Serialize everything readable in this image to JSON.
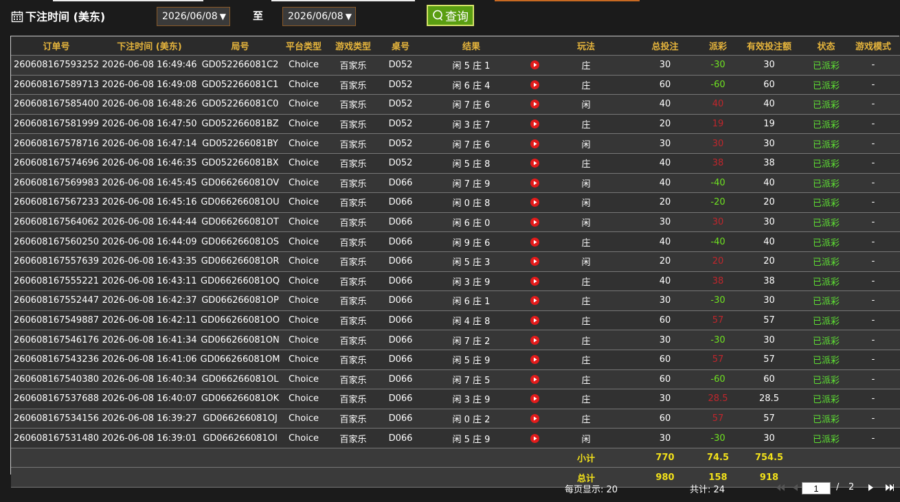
{
  "filter": {
    "label": "下注时间 (美东)",
    "start_date": "2026/06/08",
    "to_label": "至",
    "end_date": "2026/06/08",
    "query_label": "查询",
    "caret": "▼"
  },
  "table": {
    "headers": [
      "订单号",
      "下注时间 (美东)",
      "局号",
      "平台类型",
      "游戏类型",
      "桌号",
      "结果",
      "",
      "玩法",
      "总投注",
      "派彩",
      "有效投注额",
      "状态",
      "游戏模式"
    ],
    "rows": [
      [
        "260608167593252",
        "2026-06-08 16:49:46",
        "GD052266081C2",
        "Choice",
        "百家乐",
        "D052",
        "闲 5 庄 1",
        "庄",
        "30",
        "-30",
        "30",
        "已派彩",
        "-"
      ],
      [
        "260608167589713",
        "2026-06-08 16:49:08",
        "GD052266081C1",
        "Choice",
        "百家乐",
        "D052",
        "闲 6 庄 4",
        "庄",
        "60",
        "-60",
        "60",
        "已派彩",
        "-"
      ],
      [
        "260608167585400",
        "2026-06-08 16:48:26",
        "GD052266081C0",
        "Choice",
        "百家乐",
        "D052",
        "闲 7 庄 6",
        "闲",
        "40",
        "40",
        "40",
        "已派彩",
        "-"
      ],
      [
        "260608167581999",
        "2026-06-08 16:47:50",
        "GD052266081BZ",
        "Choice",
        "百家乐",
        "D052",
        "闲 3 庄 7",
        "庄",
        "20",
        "19",
        "19",
        "已派彩",
        "-"
      ],
      [
        "260608167578716",
        "2026-06-08 16:47:14",
        "GD052266081BY",
        "Choice",
        "百家乐",
        "D052",
        "闲 7 庄 6",
        "闲",
        "30",
        "30",
        "30",
        "已派彩",
        "-"
      ],
      [
        "260608167574696",
        "2026-06-08 16:46:35",
        "GD052266081BX",
        "Choice",
        "百家乐",
        "D052",
        "闲 5 庄 8",
        "庄",
        "40",
        "38",
        "38",
        "已派彩",
        "-"
      ],
      [
        "260608167569983",
        "2026-06-08 16:45:45",
        "GD066266081OV",
        "Choice",
        "百家乐",
        "D066",
        "闲 7 庄 9",
        "闲",
        "40",
        "-40",
        "40",
        "已派彩",
        "-"
      ],
      [
        "260608167567233",
        "2026-06-08 16:45:16",
        "GD066266081OU",
        "Choice",
        "百家乐",
        "D066",
        "闲 0 庄 8",
        "闲",
        "20",
        "-20",
        "20",
        "已派彩",
        "-"
      ],
      [
        "260608167564062",
        "2026-06-08 16:44:44",
        "GD066266081OT",
        "Choice",
        "百家乐",
        "D066",
        "闲 6 庄 0",
        "闲",
        "30",
        "30",
        "30",
        "已派彩",
        "-"
      ],
      [
        "260608167560250",
        "2026-06-08 16:44:09",
        "GD066266081OS",
        "Choice",
        "百家乐",
        "D066",
        "闲 9 庄 6",
        "庄",
        "40",
        "-40",
        "40",
        "已派彩",
        "-"
      ],
      [
        "260608167557639",
        "2026-06-08 16:43:35",
        "GD066266081OR",
        "Choice",
        "百家乐",
        "D066",
        "闲 5 庄 3",
        "闲",
        "20",
        "20",
        "20",
        "已派彩",
        "-"
      ],
      [
        "260608167555221",
        "2026-06-08 16:43:11",
        "GD066266081OQ",
        "Choice",
        "百家乐",
        "D066",
        "闲 3 庄 9",
        "庄",
        "40",
        "38",
        "38",
        "已派彩",
        "-"
      ],
      [
        "260608167552447",
        "2026-06-08 16:42:37",
        "GD066266081OP",
        "Choice",
        "百家乐",
        "D066",
        "闲 6 庄 1",
        "庄",
        "30",
        "-30",
        "30",
        "已派彩",
        "-"
      ],
      [
        "260608167549887",
        "2026-06-08 16:42:11",
        "GD066266081OO",
        "Choice",
        "百家乐",
        "D066",
        "闲 4 庄 8",
        "庄",
        "60",
        "57",
        "57",
        "已派彩",
        "-"
      ],
      [
        "260608167546176",
        "2026-06-08 16:41:34",
        "GD066266081ON",
        "Choice",
        "百家乐",
        "D066",
        "闲 7 庄 2",
        "庄",
        "30",
        "-30",
        "30",
        "已派彩",
        "-"
      ],
      [
        "260608167543236",
        "2026-06-08 16:41:06",
        "GD066266081OM",
        "Choice",
        "百家乐",
        "D066",
        "闲 5 庄 9",
        "庄",
        "60",
        "57",
        "57",
        "已派彩",
        "-"
      ],
      [
        "260608167540380",
        "2026-06-08 16:40:34",
        "GD066266081OL",
        "Choice",
        "百家乐",
        "D066",
        "闲 7 庄 5",
        "庄",
        "60",
        "-60",
        "60",
        "已派彩",
        "-"
      ],
      [
        "260608167537688",
        "2026-06-08 16:40:07",
        "GD066266081OK",
        "Choice",
        "百家乐",
        "D066",
        "闲 3 庄 9",
        "庄",
        "30",
        "28.5",
        "28.5",
        "已派彩",
        "-"
      ],
      [
        "260608167534156",
        "2026-06-08 16:39:27",
        "GD066266081OJ",
        "Choice",
        "百家乐",
        "D066",
        "闲 0 庄 2",
        "庄",
        "60",
        "57",
        "57",
        "已派彩",
        "-"
      ],
      [
        "260608167531480",
        "2026-06-08 16:39:01",
        "GD066266081OI",
        "Choice",
        "百家乐",
        "D066",
        "闲 5 庄 9",
        "闲",
        "30",
        "-30",
        "30",
        "已派彩",
        "-"
      ]
    ],
    "subtotal": {
      "label": "小计",
      "total_bet": "770",
      "payout": "74.5",
      "valid_bet": "754.5"
    },
    "grand_total": {
      "label": "总计",
      "total_bet": "980",
      "payout": "158",
      "valid_bet": "918"
    }
  },
  "pagination": {
    "per_page": "每页显示: 20",
    "total": "共计: 24",
    "current_page": "1",
    "slash": "/",
    "total_pages": "2"
  },
  "colors": {
    "header_text": "#e5b43c",
    "negative": "#6fe221",
    "positive": "#c1262c",
    "status": "#5ee033",
    "total_text": "#f2e11a",
    "query_button": "#5a9e12"
  },
  "icons": {
    "calendar": "calendar-icon",
    "search": "search-icon",
    "play": "play-icon",
    "first": "first-page-icon",
    "prev": "prev-page-icon",
    "next": "next-page-icon",
    "last": "last-page-icon"
  }
}
